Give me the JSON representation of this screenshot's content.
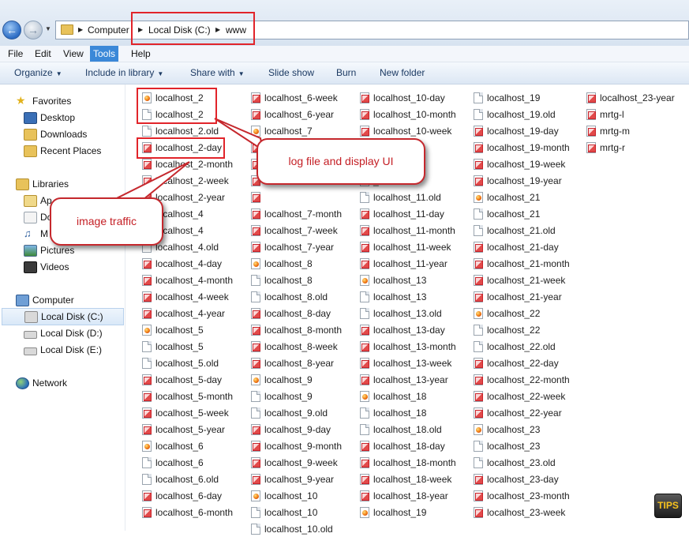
{
  "address": {
    "crumbs": [
      "Computer",
      "Local Disk (C:)",
      "www"
    ]
  },
  "menu": [
    "File",
    "Edit",
    "View",
    "Tools",
    "Help"
  ],
  "menu_active": "Tools",
  "commands": {
    "organize": "Organize",
    "include_in_library": "Include in library",
    "share_with": "Share with",
    "slide_show": "Slide show",
    "burn": "Burn",
    "new_folder": "New folder"
  },
  "sidebar": {
    "favorites": "Favorites",
    "desktop": "Desktop",
    "downloads": "Downloads",
    "recent_places": "Recent Places",
    "libraries": "Libraries",
    "apps": "Ap",
    "documents": "Do",
    "music": "M",
    "pictures": "Pictures",
    "videos": "Videos",
    "computer": "Computer",
    "disk_c": "Local Disk (C:)",
    "disk_d": "Local Disk (D:)",
    "disk_e": "Local Disk (E:)",
    "network": "Network"
  },
  "files": {
    "col1": [
      {
        "name": "localhost_2",
        "type": "html"
      },
      {
        "name": "localhost_2",
        "type": "doc"
      },
      {
        "name": "localhost_2.old",
        "type": "doc"
      },
      {
        "name": "localhost_2-day",
        "type": "img"
      },
      {
        "name": "localhost_2-month",
        "type": "img"
      },
      {
        "name": "localhost_2-week",
        "type": "img"
      },
      {
        "name": "localhost_2-year",
        "type": "img"
      },
      {
        "name": "localhost_4",
        "type": "html"
      },
      {
        "name": "localhost_4",
        "type": "doc"
      },
      {
        "name": "localhost_4.old",
        "type": "doc"
      },
      {
        "name": "localhost_4-day",
        "type": "img"
      },
      {
        "name": "localhost_4-month",
        "type": "img"
      },
      {
        "name": "localhost_4-week",
        "type": "img"
      },
      {
        "name": "localhost_4-year",
        "type": "img"
      },
      {
        "name": "localhost_5",
        "type": "html"
      },
      {
        "name": "localhost_5",
        "type": "doc"
      },
      {
        "name": "localhost_5.old",
        "type": "doc"
      },
      {
        "name": "localhost_5-day",
        "type": "img"
      },
      {
        "name": "localhost_5-month",
        "type": "img"
      },
      {
        "name": "localhost_5-week",
        "type": "img"
      },
      {
        "name": "localhost_5-year",
        "type": "img"
      },
      {
        "name": "localhost_6",
        "type": "html"
      },
      {
        "name": "localhost_6",
        "type": "doc"
      },
      {
        "name": "localhost_6.old",
        "type": "doc"
      },
      {
        "name": "localhost_6-day",
        "type": "img"
      },
      {
        "name": "localhost_6-month",
        "type": "img"
      }
    ],
    "col2": [
      {
        "name": "localhost_6-week",
        "type": "img"
      },
      {
        "name": "localhost_6-year",
        "type": "img"
      },
      {
        "name": "localhost_7",
        "type": "html"
      },
      {
        "name": "",
        "type": "img"
      },
      {
        "name": "",
        "type": "img"
      },
      {
        "name": "",
        "type": "img"
      },
      {
        "name": "",
        "type": "img"
      },
      {
        "name": "localhost_7-month",
        "type": "img"
      },
      {
        "name": "localhost_7-week",
        "type": "img"
      },
      {
        "name": "localhost_7-year",
        "type": "img"
      },
      {
        "name": "localhost_8",
        "type": "html"
      },
      {
        "name": "localhost_8",
        "type": "doc"
      },
      {
        "name": "localhost_8.old",
        "type": "doc"
      },
      {
        "name": "localhost_8-day",
        "type": "img"
      },
      {
        "name": "localhost_8-month",
        "type": "img"
      },
      {
        "name": "localhost_8-week",
        "type": "img"
      },
      {
        "name": "localhost_8-year",
        "type": "img"
      },
      {
        "name": "localhost_9",
        "type": "html"
      },
      {
        "name": "localhost_9",
        "type": "doc"
      },
      {
        "name": "localhost_9.old",
        "type": "doc"
      },
      {
        "name": "localhost_9-day",
        "type": "img"
      },
      {
        "name": "localhost_9-month",
        "type": "img"
      },
      {
        "name": "localhost_9-week",
        "type": "img"
      },
      {
        "name": "localhost_9-year",
        "type": "img"
      },
      {
        "name": "localhost_10",
        "type": "html"
      },
      {
        "name": "localhost_10",
        "type": "doc"
      },
      {
        "name": "localhost_10.old",
        "type": "doc"
      }
    ],
    "col3": [
      {
        "name": "localhost_10-day",
        "type": "img"
      },
      {
        "name": "localhost_10-month",
        "type": "img"
      },
      {
        "name": "localhost_10-week",
        "type": "img"
      },
      {
        "name": "-year",
        "type": "img"
      },
      {
        "name": "",
        "type": "html"
      },
      {
        "name": "_11",
        "type": "doc"
      },
      {
        "name": "localhost_11.old",
        "type": "doc"
      },
      {
        "name": "localhost_11-day",
        "type": "img"
      },
      {
        "name": "localhost_11-month",
        "type": "img"
      },
      {
        "name": "localhost_11-week",
        "type": "img"
      },
      {
        "name": "localhost_11-year",
        "type": "img"
      },
      {
        "name": "localhost_13",
        "type": "html"
      },
      {
        "name": "localhost_13",
        "type": "doc"
      },
      {
        "name": "localhost_13.old",
        "type": "doc"
      },
      {
        "name": "localhost_13-day",
        "type": "img"
      },
      {
        "name": "localhost_13-month",
        "type": "img"
      },
      {
        "name": "localhost_13-week",
        "type": "img"
      },
      {
        "name": "localhost_13-year",
        "type": "img"
      },
      {
        "name": "localhost_18",
        "type": "html"
      },
      {
        "name": "localhost_18",
        "type": "doc"
      },
      {
        "name": "localhost_18.old",
        "type": "doc"
      },
      {
        "name": "localhost_18-day",
        "type": "img"
      },
      {
        "name": "localhost_18-month",
        "type": "img"
      },
      {
        "name": "localhost_18-week",
        "type": "img"
      },
      {
        "name": "localhost_18-year",
        "type": "img"
      },
      {
        "name": "localhost_19",
        "type": "html"
      }
    ],
    "col4": [
      {
        "name": "localhost_19",
        "type": "doc"
      },
      {
        "name": "localhost_19.old",
        "type": "doc"
      },
      {
        "name": "localhost_19-day",
        "type": "img"
      },
      {
        "name": "localhost_19-month",
        "type": "img"
      },
      {
        "name": "localhost_19-week",
        "type": "img"
      },
      {
        "name": "localhost_19-year",
        "type": "img"
      },
      {
        "name": "localhost_21",
        "type": "html"
      },
      {
        "name": "localhost_21",
        "type": "doc"
      },
      {
        "name": "localhost_21.old",
        "type": "doc"
      },
      {
        "name": "localhost_21-day",
        "type": "img"
      },
      {
        "name": "localhost_21-month",
        "type": "img"
      },
      {
        "name": "localhost_21-week",
        "type": "img"
      },
      {
        "name": "localhost_21-year",
        "type": "img"
      },
      {
        "name": "localhost_22",
        "type": "html"
      },
      {
        "name": "localhost_22",
        "type": "doc"
      },
      {
        "name": "localhost_22.old",
        "type": "doc"
      },
      {
        "name": "localhost_22-day",
        "type": "img"
      },
      {
        "name": "localhost_22-month",
        "type": "img"
      },
      {
        "name": "localhost_22-week",
        "type": "img"
      },
      {
        "name": "localhost_22-year",
        "type": "img"
      },
      {
        "name": "localhost_23",
        "type": "html"
      },
      {
        "name": "localhost_23",
        "type": "doc"
      },
      {
        "name": "localhost_23.old",
        "type": "doc"
      },
      {
        "name": "localhost_23-day",
        "type": "img"
      },
      {
        "name": "localhost_23-month",
        "type": "img"
      },
      {
        "name": "localhost_23-week",
        "type": "img"
      }
    ],
    "col5": [
      {
        "name": "localhost_23-year",
        "type": "img"
      },
      {
        "name": "mrtg-l",
        "type": "img"
      },
      {
        "name": "mrtg-m",
        "type": "img"
      },
      {
        "name": "mrtg-r",
        "type": "img"
      }
    ]
  },
  "annotations": {
    "log_callout": "log file and display UI",
    "image_callout": "image traffic",
    "tips_badge": "TIPS",
    "annotation_color": "#e1242a"
  }
}
